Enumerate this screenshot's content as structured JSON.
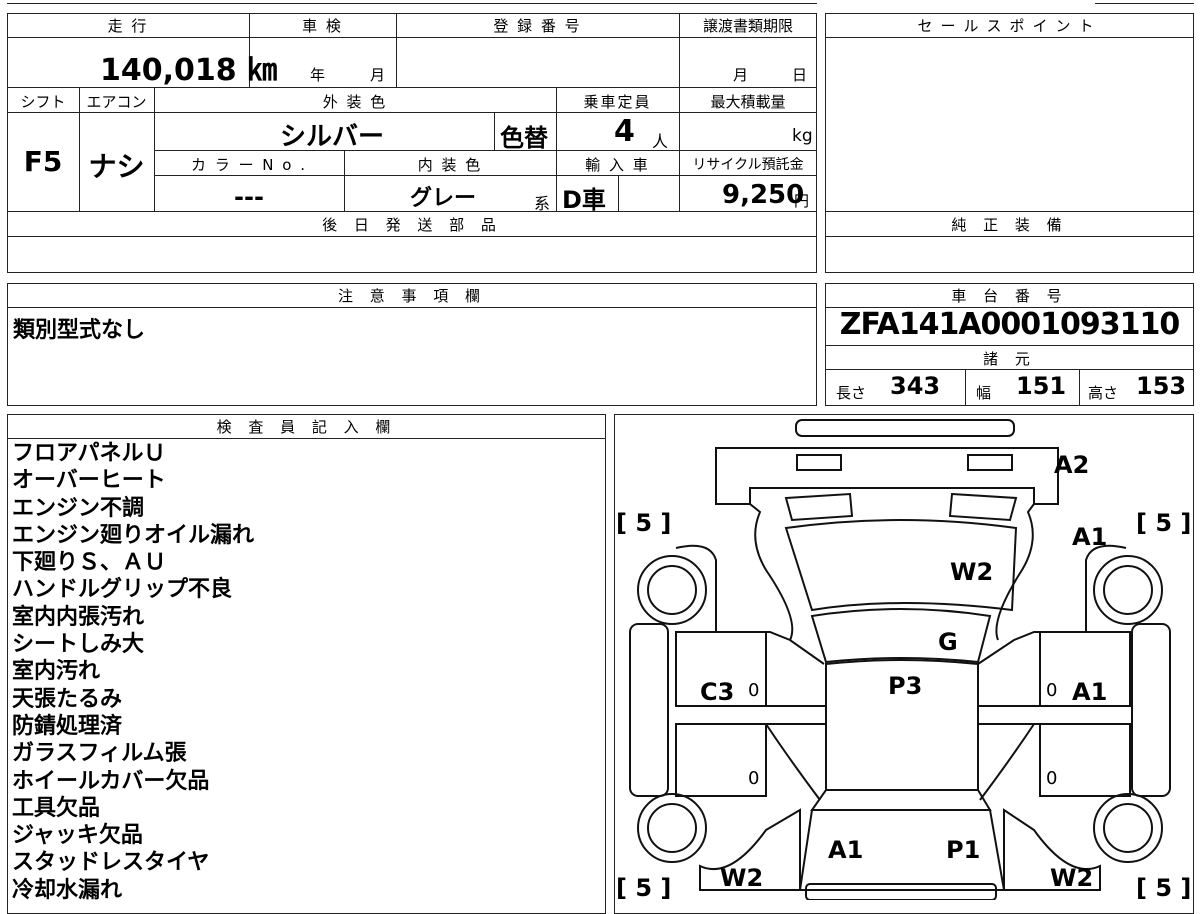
{
  "header": {
    "mileage_label": "走 行",
    "inspection_label": "車 検",
    "registration_label": "登 録 番 号",
    "transfer_deadline_label": "譲渡書類期限",
    "mileage_value": "140,018 ㎞",
    "year_unit": "年",
    "month_unit": "月",
    "deadline_month_unit": "月",
    "deadline_day_unit": "日"
  },
  "specs": {
    "shift_label": "シフト",
    "ac_label": "エアコン",
    "exterior_color_label": "外 装 色",
    "capacity_label": "乗車定員",
    "max_load_label": "最大積載量",
    "shift_value": "F5",
    "ac_value": "ナシ",
    "exterior_color_value": "シルバー",
    "color_change": "色替",
    "capacity_value": "4",
    "capacity_unit": "人",
    "load_unit": "kg",
    "color_no_label": "カ ラ ー N o .",
    "interior_color_label": "内 装 色",
    "import_label": "輸 入 車",
    "recycle_label": "リサイクル預託金",
    "color_no_value": "---",
    "interior_color_value": "グレー",
    "interior_suffix": "系",
    "import_value": "D車",
    "recycle_value": "9,250",
    "recycle_unit": "円"
  },
  "sale_points_label": "セールスポイント",
  "later_parts_label": "後 日 発 送 部 品",
  "genuine_equipment_label": "純 正 装 備",
  "caution": {
    "label": "注 意 事 項 欄",
    "text": "類別型式なし"
  },
  "chassis": {
    "label": "車 台 番 号",
    "value": "ZFA141A0001093110",
    "dims_label": "諸 元",
    "length_label": "長さ",
    "length_value": "343",
    "width_label": "幅",
    "width_value": "151",
    "height_label": "高さ",
    "height_value": "153"
  },
  "inspector": {
    "label": "検 査 員 記 入 欄",
    "notes": [
      "フロアパネルＵ",
      "オーバーヒート",
      "エンジン不調",
      "エンジン廻りオイル漏れ",
      "下廻りＳ、ＡＵ",
      "ハンドルグリップ不良",
      "室内内張汚れ",
      "シートしみ大",
      "室内汚れ",
      "天張たるみ",
      "防錆処理済",
      "ガラスフィルム張",
      "ホイールカバー欠品",
      "工具欠品",
      "ジャッキ欠品",
      "スタッドレスタイヤ",
      "冷却水漏れ"
    ]
  },
  "diagram": {
    "tire_fl": "[ 5 ]",
    "tire_fr": "[ 5 ]",
    "tire_rl": "[ 5 ]",
    "tire_rr": "[ 5 ]",
    "rear_bumper": "A2",
    "front_right_fender": "A1",
    "roof": "W2",
    "rear_glass": "G",
    "left_panel": "C3",
    "right_door": "A1",
    "trunk": "P3",
    "hood_left": "A1",
    "hood_right": "P1",
    "front_left_corner": "W2",
    "front_right_corner": "W2",
    "left_front_door": "0",
    "left_rear_door": "0",
    "right_front_door": "0",
    "right_rear_door": "0"
  }
}
